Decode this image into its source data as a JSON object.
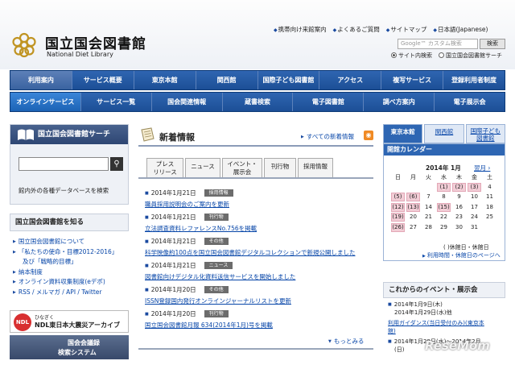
{
  "header": {
    "site_name_jp": "国立国会図書館",
    "site_name_en": "National Diet Library",
    "links": [
      "携帯向け来館案内",
      "よくあるご質問",
      "サイトマップ",
      "日本語(Japanese)"
    ],
    "search_placeholder": "Google™ カスタム検索",
    "search_button": "検索",
    "scope_options": [
      "サイト内検索",
      "国立国会図書館サーチ"
    ]
  },
  "nav1": [
    "利用案内",
    "サービス概要",
    "東京本館",
    "関西館",
    "国際子ども図書館",
    "アクセス",
    "複写サービス",
    "登録利用者制度"
  ],
  "nav2": [
    "オンラインサービス",
    "サービス一覧",
    "国会関連情報",
    "蔵書検索",
    "電子図書館",
    "調べ方案内",
    "電子展示会"
  ],
  "left": {
    "search_title": "国立国会図書館サーチ",
    "search_note": "館内外の各種データベースを検索",
    "search_btn_icon": "magnifier-icon",
    "know_title": "国立国会図書館を知る",
    "know_items": [
      "国立国会図書館について",
      "「私たちの使命・目標2012-2016」",
      "及び「戦略的目標」",
      "納本制度",
      "オンライン資料収集制度(eデポ)",
      "RSS / メルマガ / API / Twitter"
    ],
    "banner1_small": "ひなぎく",
    "banner1_big": "NDL東日本大震災アーカイブ",
    "banner1_badge": "NDL",
    "banner2_a": "国会会議録",
    "banner2_b": "検索システム"
  },
  "news": {
    "title": "新着情報",
    "all_link": "すべての新着情報",
    "tabs": [
      "プレス\nリリース",
      "ニュース",
      "イベント・\n展示会",
      "刊行物",
      "採用情報"
    ],
    "items": [
      {
        "date": "2014年1月21日",
        "tag": "採用情報",
        "text": "職員採用説明会のご案内を更新"
      },
      {
        "date": "2014年1月21日",
        "tag": "刊行物",
        "text": "立法調査資料レファレンスNo.756を掲載"
      },
      {
        "date": "2014年1月21日",
        "tag": "その他",
        "text": "科学映像約100点を国立国会図書館デジタルコレクションで新規公開しました"
      },
      {
        "date": "2014年1月21日",
        "tag": "ニュース",
        "text": "図書館向けデジタル化資料送信サービスを開始しました"
      },
      {
        "date": "2014年1月20日",
        "tag": "その他",
        "text": "ISSN登録国内発行オンラインジャーナルリストを更新"
      },
      {
        "date": "2014年1月20日",
        "tag": "刊行物",
        "text": "国立国会図書館月報 634(2014年1月)号を掲載"
      }
    ],
    "more": "もっとみる"
  },
  "right": {
    "tabs": [
      "東京本館",
      "関西館",
      "国際子ども\n図書館"
    ],
    "cal_title": "開館カレンダー",
    "month": "2014年 1月",
    "next": "翌月 ›",
    "weekdays": [
      "日",
      "月",
      "火",
      "水",
      "木",
      "金",
      "土"
    ],
    "days": [
      "",
      "",
      "",
      "(1)",
      "(2)",
      "(3)",
      "4",
      "(5)",
      "(6)",
      "7",
      "8",
      "9",
      "10",
      "11",
      "(12)",
      "(13)",
      "14",
      "(15)",
      "16",
      "17",
      "18",
      "(19)",
      "20",
      "21",
      "22",
      "23",
      "24",
      "25",
      "(26)",
      "27",
      "28",
      "29",
      "30",
      "31",
      ""
    ],
    "legend": "( )休館日・休館日",
    "link": "利用時間・休館日のページへ",
    "events_title": "これからのイベント・展示会",
    "events": [
      "2014年1月9日(木)",
      "2014年1月29日(水)他",
      "利用ガイダンス(当日受付のみ)(東京本",
      "館)",
      "2014年1月29日(水)～2014年2月",
      "(日)"
    ]
  },
  "watermark": "ReseMom"
}
